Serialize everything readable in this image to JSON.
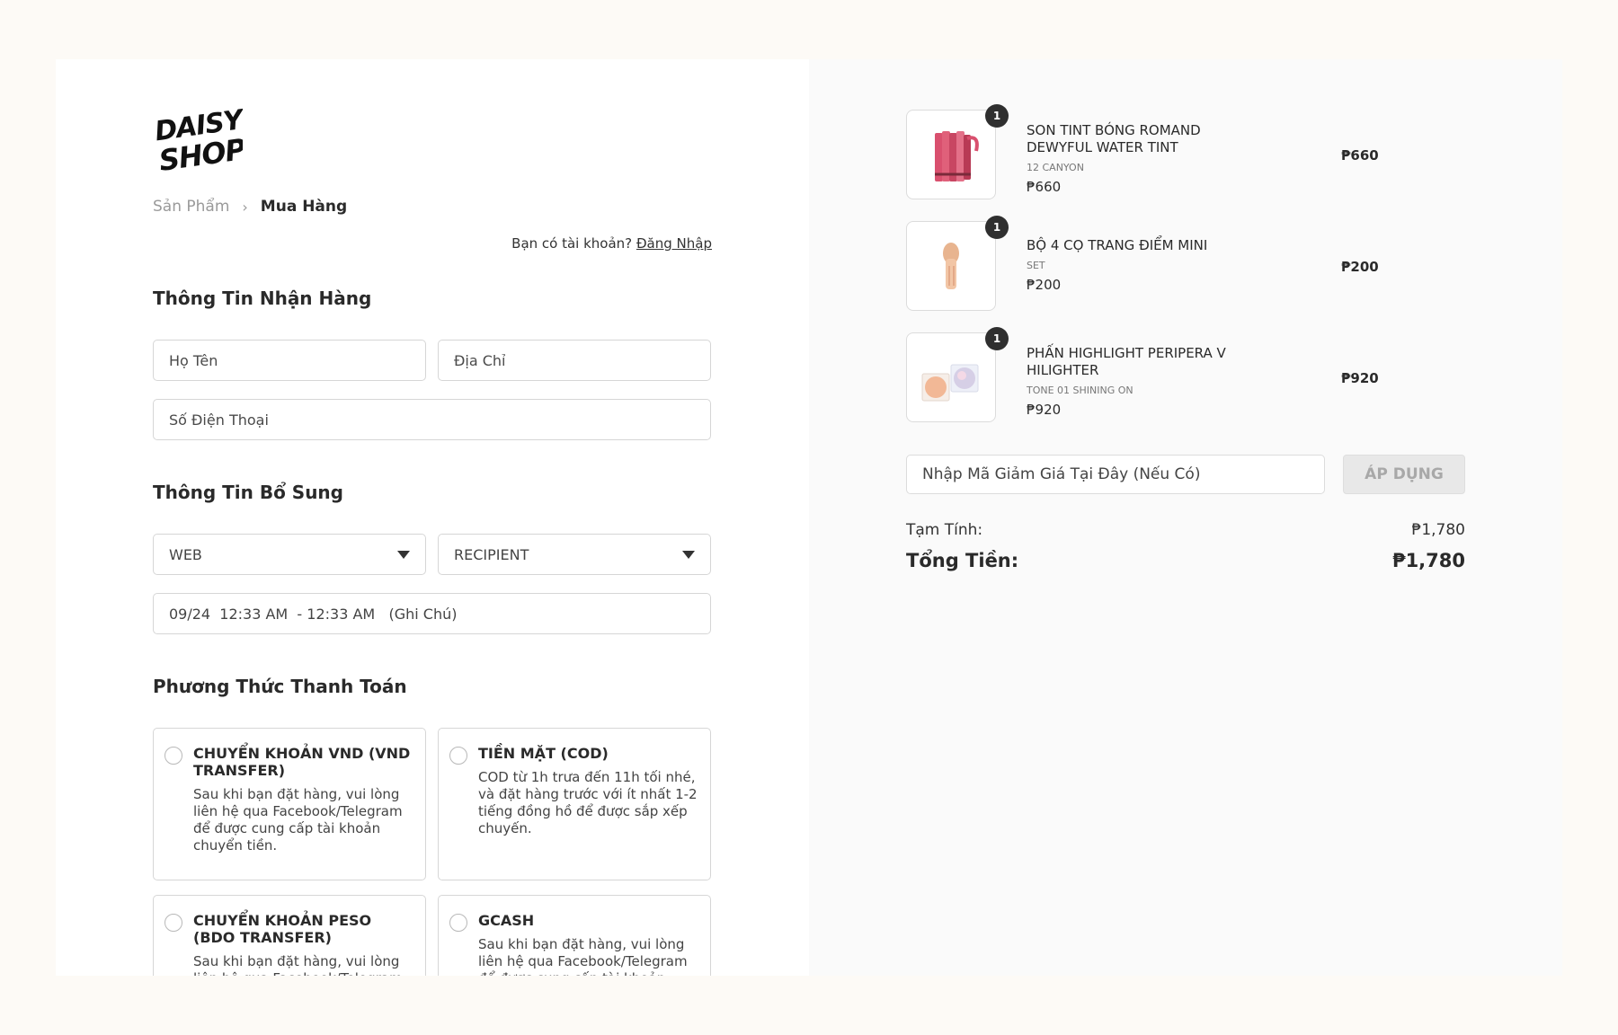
{
  "logo": {
    "line1": "DAISY",
    "line2": "SHOP"
  },
  "breadcrumb": {
    "previous": "Sản Phẩm",
    "separator": "›",
    "current": "Mua Hàng"
  },
  "account": {
    "prompt": "Bạn có tài khoản?",
    "login_link": "Đăng Nhập"
  },
  "shipping": {
    "title": "Thông Tin Nhận Hàng",
    "name_placeholder": "Họ Tên",
    "address_placeholder": "Địa Chỉ",
    "phone_placeholder": "Số Điện Thoại"
  },
  "extra": {
    "title": "Thông Tin Bổ Sung",
    "source_select": "WEB",
    "recipient_select": "RECIPIENT",
    "note_value": "09/24  12:33 AM  - 12:33 AM   (Ghi Chú)"
  },
  "payment": {
    "title": "Phương Thức Thanh Toán",
    "methods": [
      {
        "title": "CHUYỂN KHOẢN VND (VND TRANSFER)",
        "desc": "Sau khi bạn đặt hàng, vui lòng liên hệ qua Facebook/Telegram để được cung cấp tài khoản chuyển tiền."
      },
      {
        "title": "TIỀN MẶT (COD)",
        "desc": "COD từ 1h trưa đến 11h tối nhé, và đặt hàng trước với ít nhất 1-2 tiếng đồng hồ để được sắp xếp chuyến."
      },
      {
        "title": "CHUYỂN KHOẢN PESO (BDO TRANSFER)",
        "desc": "Sau khi bạn đặt hàng, vui lòng liên hệ qua Facebook/Telegram để được cung cấp tài khoản chuyển tiền."
      },
      {
        "title": "GCASH",
        "desc": "Sau khi bạn đặt hàng, vui lòng liên hệ qua Facebook/Telegram để được cung cấp tài khoản chuyển tiền."
      }
    ]
  },
  "cart": {
    "items": [
      {
        "qty": "1",
        "name": "SON TINT BÓNG ROMAND DEWYFUL WATER TINT",
        "variant": "12 CANYON",
        "unit_price": "₱660",
        "line_total": "₱660"
      },
      {
        "qty": "1",
        "name": "BỘ 4 CỌ TRANG ĐIỂM MINI",
        "variant": "SET",
        "unit_price": "₱200",
        "line_total": "₱200"
      },
      {
        "qty": "1",
        "name": "PHẤN HIGHLIGHT PERIPERA V HILIGHTER",
        "variant": "TONE 01 SHINING ON",
        "unit_price": "₱920",
        "line_total": "₱920"
      }
    ],
    "coupon_placeholder": "Nhập Mã Giảm Giá Tại Đây (Nếu Có)",
    "apply_label": "ÁP DỤNG",
    "subtotal_label": "Tạm Tính:",
    "subtotal_value": "₱1,780",
    "total_label": "Tổng Tiền:",
    "total_value": "₱1,780"
  }
}
